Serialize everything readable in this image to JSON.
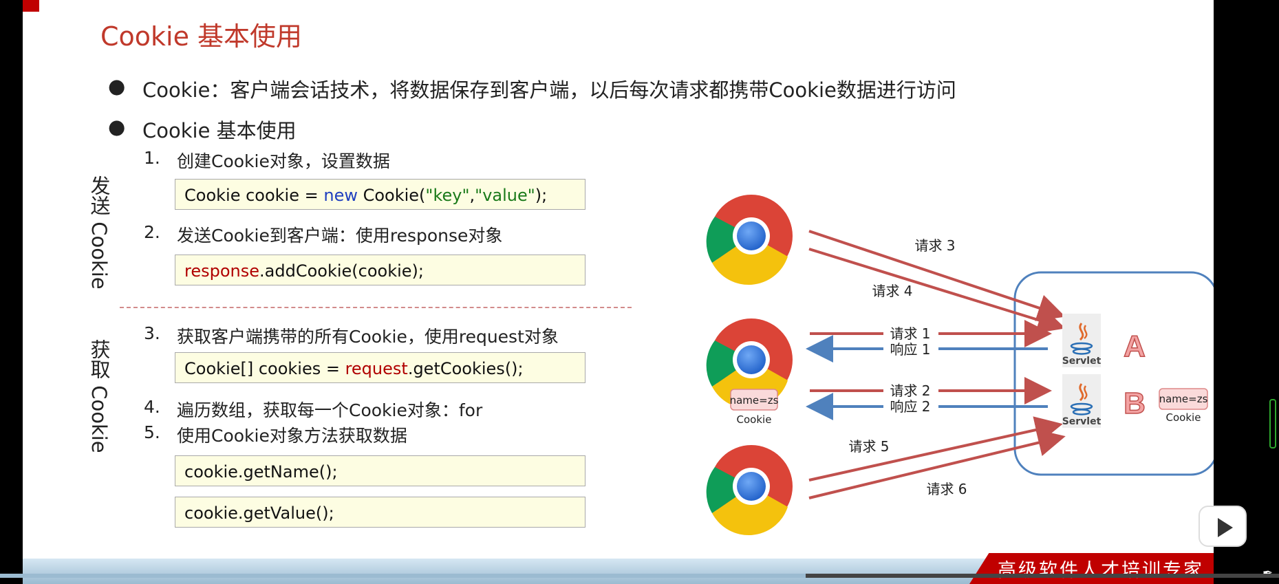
{
  "slide": {
    "title": "Cookie 基本使用",
    "bullets": [
      "Cookie：客户端会话技术，将数据保存到客户端，以后每次请求都携带Cookie数据进行访问",
      "Cookie 基本使用"
    ],
    "bullet_symbol": "●",
    "steps": [
      {
        "num": "1.",
        "text": "创建Cookie对象，设置数据"
      },
      {
        "num": "2.",
        "text": "发送Cookie到客户端：使用response对象"
      },
      {
        "num": "3.",
        "text": "获取客户端携带的所有Cookie，使用request对象"
      },
      {
        "num": "4.",
        "text": "遍历数组，获取每一个Cookie对象：for"
      },
      {
        "num": "5.",
        "text": "使用Cookie对象方法获取数据"
      }
    ],
    "code": {
      "c1": {
        "a": "Cookie cookie = ",
        "kw": "new",
        "b": " Cookie(",
        "s1": "\"key\"",
        "c": ",",
        "s2": "\"value\"",
        "d": ");"
      },
      "c2": {
        "obj": "response",
        "rest": ".addCookie(cookie);"
      },
      "c3": {
        "a": "Cookie[] cookies = ",
        "obj": "request",
        "rest": ".getCookies();"
      },
      "c4": "cookie.getName();",
      "c5": "cookie.getValue();"
    },
    "side_labels": {
      "send": "发送 Cookie",
      "get": "获取 Cookie"
    },
    "footer": "高级软件人才培训专家"
  },
  "diagram": {
    "requests": [
      "请求 3",
      "请求 4",
      "请求 1",
      "响应 1",
      "请求 2",
      "响应 2",
      "请求 5",
      "请求 6"
    ],
    "servlet_label": "Servlet",
    "server_labels": [
      "A",
      "B"
    ],
    "cookie_value": "name=zs",
    "cookie_caption": "Cookie",
    "colors": {
      "request": "#c0504d",
      "response": "#4f81bd",
      "server_border": "#4f81bd"
    }
  },
  "player": {
    "progress": 0.63
  }
}
